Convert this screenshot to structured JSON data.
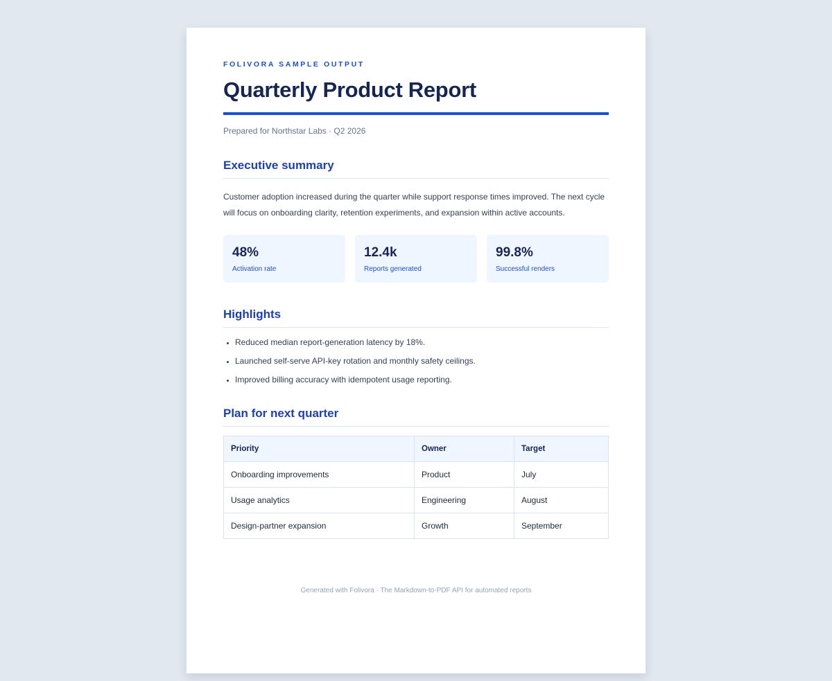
{
  "eyebrow": "FOLIVORA SAMPLE OUTPUT",
  "title": "Quarterly Product Report",
  "subtitle": "Prepared for Northstar Labs · Q2 2026",
  "summary": {
    "heading": "Executive summary",
    "text": "Customer adoption increased during the quarter while support response times improved. The next cycle will focus on onboarding clarity, retention experiments, and expansion within active accounts."
  },
  "stats": [
    {
      "value": "48%",
      "label": "Activation rate"
    },
    {
      "value": "12.4k",
      "label": "Reports generated"
    },
    {
      "value": "99.8%",
      "label": "Successful renders"
    }
  ],
  "highlights": {
    "heading": "Highlights",
    "items": [
      "Reduced median report-generation latency by 18%.",
      "Launched self-serve API-key rotation and monthly safety ceilings.",
      "Improved billing accuracy with idempotent usage reporting."
    ]
  },
  "plan": {
    "heading": "Plan for next quarter",
    "columns": [
      "Priority",
      "Owner",
      "Target"
    ],
    "rows": [
      [
        "Onboarding improvements",
        "Product",
        "July"
      ],
      [
        "Usage analytics",
        "Engineering",
        "August"
      ],
      [
        "Design-partner expansion",
        "Growth",
        "September"
      ]
    ]
  },
  "footer": "Generated with Folivora · The Markdown-to-PDF API for automated reports",
  "colors": {
    "background": "#e2e8f0",
    "accent": "#1d4ed8",
    "heading": "#1e40af",
    "title": "#172554",
    "card": "#eff6ff"
  }
}
